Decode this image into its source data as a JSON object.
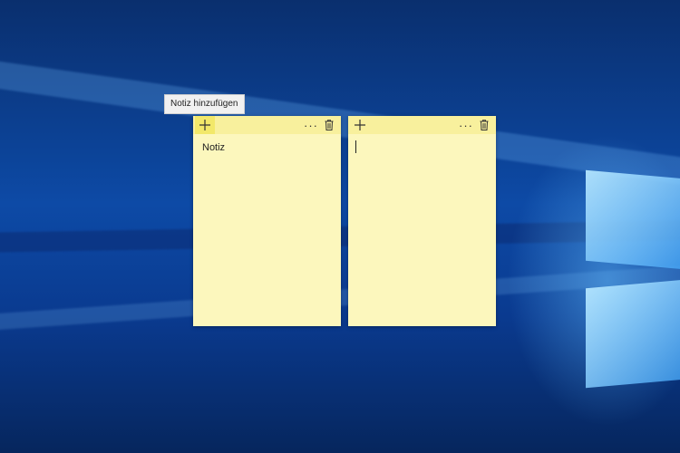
{
  "tooltip": {
    "text": "Notiz hinzufügen"
  },
  "notes": [
    {
      "text": "Notiz",
      "add_icon": "plus-icon",
      "more_icon": "ellipsis-icon",
      "delete_icon": "trash-icon",
      "more_label": "···"
    },
    {
      "text": "",
      "add_icon": "plus-icon",
      "more_icon": "ellipsis-icon",
      "delete_icon": "trash-icon",
      "more_label": "···"
    }
  ],
  "colors": {
    "note_body": "#fcf7bd",
    "note_header": "#f8f09d",
    "button_hover": "#f2e86a"
  }
}
